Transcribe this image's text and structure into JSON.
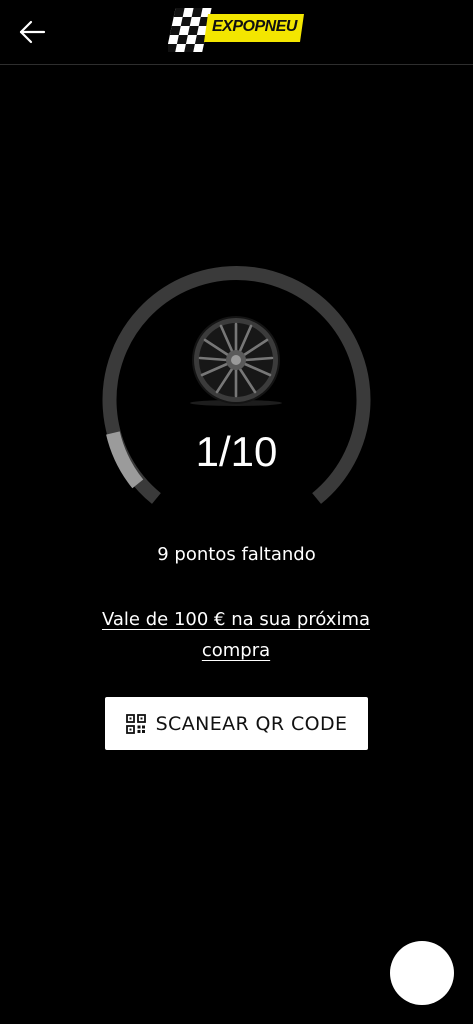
{
  "header": {
    "back_icon": "arrow-left-icon",
    "logo_text": "EXPOPNEU",
    "logo_color": "#f3e600"
  },
  "progress": {
    "current": 1,
    "total": 10,
    "display": "1/10",
    "fraction": 0.1,
    "track_color": "#3a3a3a",
    "fill_color": "#9b9b9b",
    "image": "wheel-rim-icon"
  },
  "status": {
    "remaining_text": "9 pontos faltando",
    "reward_text": "Vale de 100 € na sua próxima compra"
  },
  "scan_button": {
    "icon": "qr-code-icon",
    "label": "SCANEAR QR CODE"
  },
  "fab": {
    "color": "#ffffff"
  }
}
